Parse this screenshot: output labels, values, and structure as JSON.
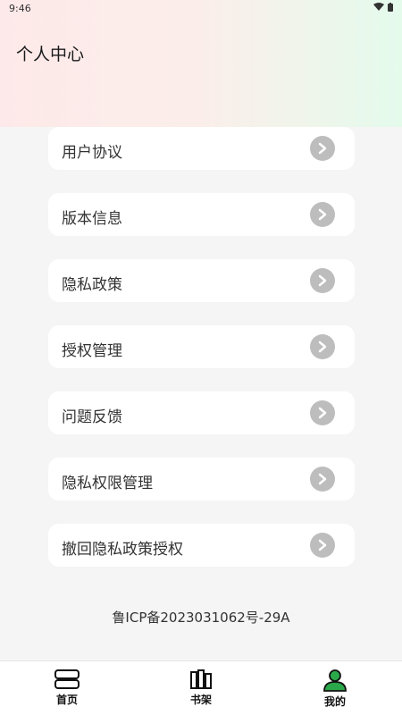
{
  "status_bar": {
    "time": "9:46"
  },
  "header": {
    "title": "个人中心"
  },
  "menu": {
    "items": [
      {
        "label": "用户协议"
      },
      {
        "label": "版本信息"
      },
      {
        "label": "隐私政策"
      },
      {
        "label": "授权管理"
      },
      {
        "label": "问题反馈"
      },
      {
        "label": "隐私权限管理"
      },
      {
        "label": "撤回隐私政策授权"
      }
    ]
  },
  "footer": {
    "icp": "鲁ICP备2023031062号-29A"
  },
  "tabbar": {
    "tabs": [
      {
        "label": "首页",
        "icon": "home-stack-icon"
      },
      {
        "label": "书架",
        "icon": "bookshelf-icon"
      },
      {
        "label": "我的",
        "icon": "user-icon",
        "active": true
      }
    ]
  },
  "colors": {
    "header_left": "#fde9e9",
    "header_right": "#e4fbec",
    "accent": "#2aa84a",
    "arrow_bg": "#bdbdbd"
  }
}
